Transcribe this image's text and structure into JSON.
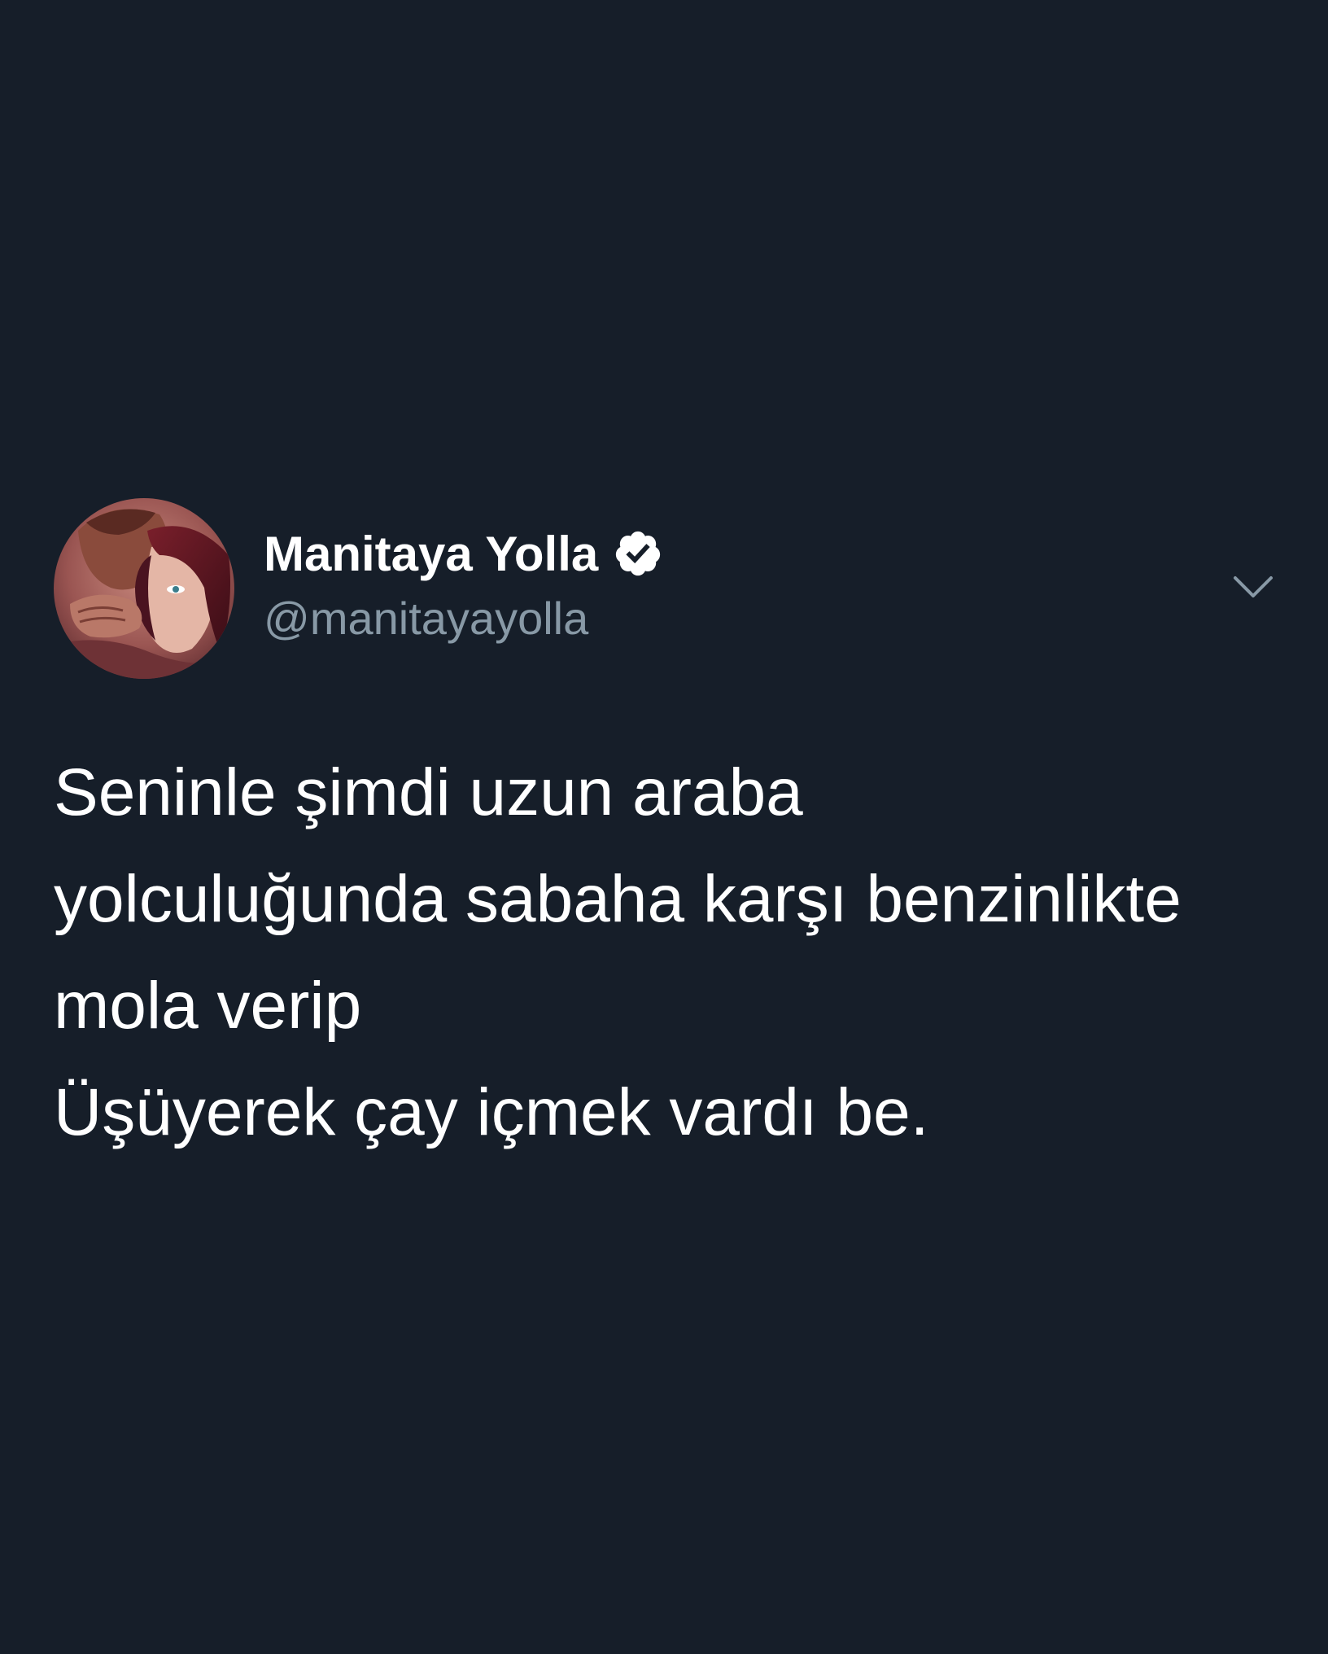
{
  "tweet": {
    "author": {
      "display_name": "Manitaya Yolla",
      "handle": "@manitayayolla",
      "verified": true
    },
    "text_lines": [
      "Seninle şimdi uzun araba",
      "yolculuğunda sabaha karşı benzinlikte",
      "mola verip",
      "Üşüyerek çay içmek vardı be."
    ]
  },
  "icons": {
    "verified": "verified-badge-icon",
    "more": "chevron-down-icon"
  },
  "colors": {
    "background": "#161e29",
    "text": "#ffffff",
    "secondary_text": "#8899a6"
  }
}
